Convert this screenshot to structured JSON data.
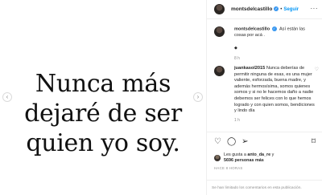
{
  "post": {
    "quote_lines": [
      "Nunca más",
      "dejaré de ser",
      "quien yo soy."
    ],
    "nav_prev": "‹",
    "nav_next": "›"
  },
  "header": {
    "username": "montsdelcastillo",
    "verified_glyph": "✓",
    "separator": "•",
    "follow_label": "Seguir",
    "more_glyph": "···"
  },
  "comments": [
    {
      "username": "montsdelcastillo",
      "text": "Así están las cosas por acá .",
      "extra": "◆",
      "time": "8 h"
    },
    {
      "username": "juankasol2015",
      "text": "Nunca deberías de permitir ninguna de esas, es una mujer valiente, esforzada, buena madre, y además hermosísima, somos quienes somos y si no le hacemos daño a nadie debemos ser felices con lo que hemos logrado y con quien somos, bendiciones y lindo día",
      "time": "1 h",
      "like_glyph": "♡"
    }
  ],
  "actions": {
    "like_glyph": "♡",
    "comment_glyph": "◯",
    "share_glyph": "➢",
    "save_glyph": "⌑"
  },
  "likes": {
    "prefix": "Les gusta a",
    "liker": "anto_da_re",
    "conjunction": "y",
    "count_text": "5696 personas más"
  },
  "posted_ago": "HACE 8 HORAS",
  "footer": {
    "comments_disabled": "Se han limitado los comentarios en esta publicación."
  },
  "colors": {
    "accent": "#0095f6",
    "verified": "#3897f0",
    "muted": "#8e8e8e",
    "text": "#262626"
  }
}
